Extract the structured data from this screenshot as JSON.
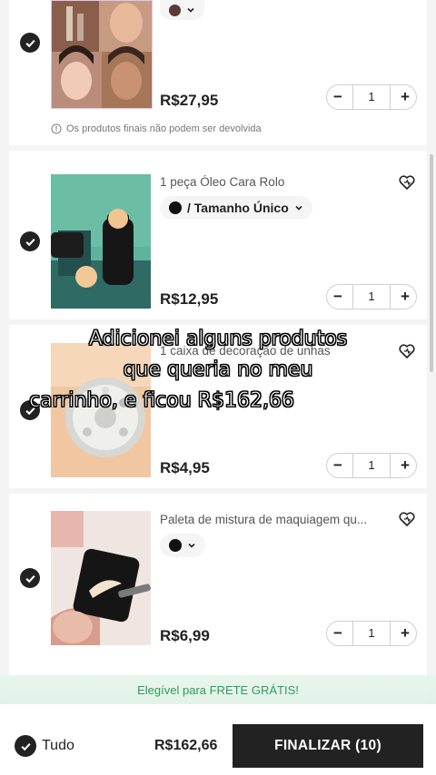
{
  "items": [
    {
      "price": "R$27,95",
      "quantity": "1",
      "note": "Os produtos finais não podem ser devolvida",
      "swatch_color": "#5a3a33"
    },
    {
      "title": "1 peça Óleo Cara Rolo",
      "variant": "/ Tamanho Único",
      "price": "R$12,95",
      "quantity": "1"
    },
    {
      "title": "1 caixa de decoração de unhas",
      "price": "R$4,95",
      "quantity": "1"
    },
    {
      "title": "Paleta de mistura de maquiagem qu...",
      "price": "R$6,99",
      "quantity": "1"
    }
  ],
  "overlay_caption": [
    "Adicionei alguns produtos",
    "que queria no meu",
    "carrinho, e ficou R$162,66"
  ],
  "free_shipping": "Elegível para FRETE GRÁTIS!",
  "footer": {
    "select_all_label": "Tudo",
    "total": "R$162,66",
    "checkout_label": "FINALIZAR (10)"
  },
  "icons": {
    "check": "check-icon",
    "wishlist": "heart-plus-icon",
    "info": "info-icon",
    "chevron": "chevron-down-icon"
  }
}
